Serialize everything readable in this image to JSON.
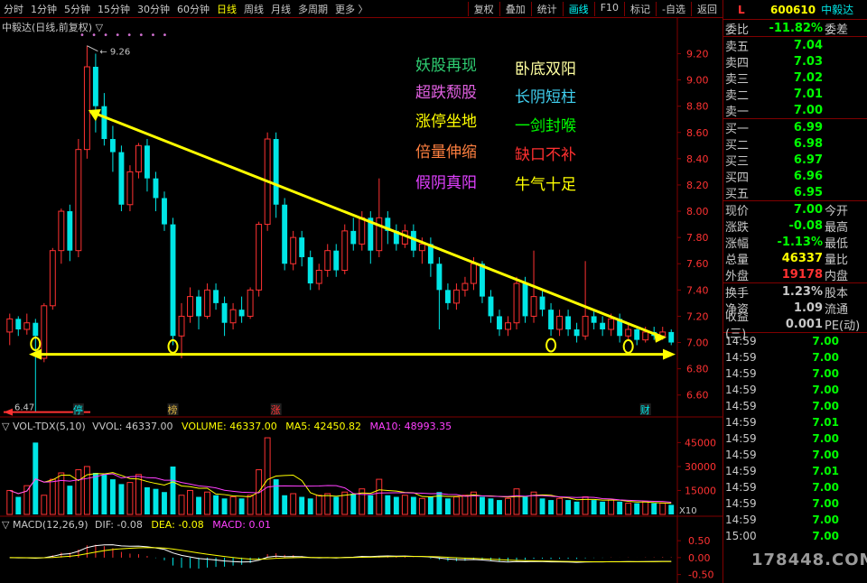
{
  "toolbar": {
    "periods": [
      "分时",
      "1分钟",
      "5分钟",
      "15分钟",
      "30分钟",
      "60分钟",
      "日线",
      "周线",
      "月线",
      "多周期",
      "更多 〉"
    ],
    "active_period": "日线",
    "buttons": [
      "复权",
      "叠加",
      "统计",
      "画线",
      "F10",
      "标记",
      "-自选",
      "返回"
    ],
    "active_button": "画线"
  },
  "chart_title": "中毅达(日线,前复权) ▽",
  "dots": "• • • • • • • •",
  "colors": {
    "up": "#ff3232",
    "down": "#00e5e5",
    "trend": "#ffff00",
    "grid": "#800000"
  },
  "chart_data": {
    "type": "candlestick",
    "ylim": [
      6.55,
      9.32
    ],
    "yticks": [
      "9.20",
      "9.00",
      "8.80",
      "8.60",
      "8.40",
      "8.20",
      "8.00",
      "7.80",
      "7.60",
      "7.40",
      "7.20",
      "7.00",
      "6.80",
      "6.60"
    ],
    "high_label": "9.26",
    "low_label": "6.47",
    "candles": [
      [
        7.08,
        7.18,
        7.22,
        6.98
      ],
      [
        7.18,
        7.1,
        7.2,
        7.05
      ],
      [
        7.1,
        7.15,
        7.22,
        7.06
      ],
      [
        7.15,
        7.05,
        7.18,
        6.47
      ],
      [
        6.88,
        7.28,
        7.3,
        6.85
      ],
      [
        7.28,
        7.7,
        7.72,
        7.25
      ],
      [
        7.7,
        8.0,
        8.02,
        7.6
      ],
      [
        8.0,
        7.7,
        8.05,
        7.62
      ],
      [
        7.7,
        8.47,
        8.55,
        7.65
      ],
      [
        8.47,
        9.1,
        9.26,
        8.4
      ],
      [
        9.1,
        8.8,
        9.2,
        8.6
      ],
      [
        8.8,
        8.55,
        8.9,
        8.5
      ],
      [
        8.55,
        8.45,
        8.65,
        8.3
      ],
      [
        8.45,
        8.05,
        8.5,
        8.0
      ],
      [
        8.05,
        8.3,
        8.35,
        8.0
      ],
      [
        8.3,
        8.5,
        8.52,
        8.25
      ],
      [
        8.5,
        8.25,
        8.55,
        8.15
      ],
      [
        8.25,
        8.1,
        8.3,
        8.0
      ],
      [
        8.1,
        7.9,
        8.15,
        7.85
      ],
      [
        7.9,
        7.05,
        7.95,
        6.98
      ],
      [
        7.05,
        7.2,
        7.3,
        6.88
      ],
      [
        7.2,
        7.35,
        7.42,
        7.15
      ],
      [
        7.35,
        7.2,
        7.4,
        7.1
      ],
      [
        7.2,
        7.4,
        7.45,
        7.18
      ],
      [
        7.4,
        7.3,
        7.45,
        7.25
      ],
      [
        7.3,
        7.15,
        7.35,
        7.05
      ],
      [
        7.15,
        7.25,
        7.3,
        7.1
      ],
      [
        7.25,
        7.2,
        7.35,
        7.15
      ],
      [
        7.2,
        7.4,
        7.42,
        7.18
      ],
      [
        7.4,
        7.9,
        7.92,
        7.35
      ],
      [
        7.9,
        8.55,
        8.6,
        7.85
      ],
      [
        8.55,
        8.05,
        8.6,
        7.95
      ],
      [
        8.05,
        7.6,
        8.1,
        7.55
      ],
      [
        7.6,
        7.8,
        7.85,
        7.55
      ],
      [
        7.8,
        7.65,
        7.85,
        7.58
      ],
      [
        7.65,
        7.45,
        7.7,
        7.4
      ],
      [
        7.45,
        7.55,
        7.6,
        7.4
      ],
      [
        7.55,
        7.7,
        7.75,
        7.5
      ],
      [
        7.7,
        7.55,
        7.75,
        7.5
      ],
      [
        7.55,
        7.85,
        7.9,
        7.52
      ],
      [
        7.85,
        7.75,
        7.95,
        7.7
      ],
      [
        7.75,
        7.95,
        8.0,
        7.7
      ],
      [
        7.95,
        7.7,
        8.0,
        7.6
      ],
      [
        7.7,
        7.95,
        8.25,
        7.65
      ],
      [
        7.95,
        7.85,
        8.0,
        7.75
      ],
      [
        7.85,
        7.75,
        7.9,
        7.7
      ],
      [
        7.75,
        7.85,
        7.9,
        7.72
      ],
      [
        7.85,
        7.7,
        7.9,
        7.65
      ],
      [
        7.7,
        7.75,
        7.8,
        7.6
      ],
      [
        7.75,
        7.6,
        7.8,
        7.5
      ],
      [
        7.6,
        7.4,
        7.65,
        7.1
      ],
      [
        7.4,
        7.3,
        7.45,
        7.25
      ],
      [
        7.3,
        7.4,
        7.45,
        7.25
      ],
      [
        7.4,
        7.45,
        7.5,
        7.35
      ],
      [
        7.45,
        7.6,
        7.65,
        7.4
      ],
      [
        7.6,
        7.35,
        7.62,
        7.3
      ],
      [
        7.35,
        7.2,
        7.4,
        7.15
      ],
      [
        7.2,
        7.1,
        7.25,
        7.05
      ],
      [
        7.1,
        7.15,
        7.2,
        7.05
      ],
      [
        7.15,
        7.45,
        7.5,
        7.1
      ],
      [
        7.45,
        7.2,
        7.5,
        7.15
      ],
      [
        7.2,
        7.35,
        7.7,
        7.15
      ],
      [
        7.35,
        7.25,
        7.4,
        7.2
      ],
      [
        7.25,
        7.1,
        7.3,
        7.05
      ],
      [
        7.1,
        7.2,
        7.25,
        7.05
      ],
      [
        7.2,
        7.1,
        7.25,
        7.05
      ],
      [
        7.1,
        7.05,
        7.15,
        7.0
      ],
      [
        7.05,
        7.2,
        7.62,
        7.02
      ],
      [
        7.2,
        7.15,
        7.25,
        7.1
      ],
      [
        7.15,
        7.1,
        7.2,
        7.05
      ],
      [
        7.1,
        7.18,
        7.22,
        7.05
      ],
      [
        7.18,
        7.05,
        7.22,
        7.0
      ],
      [
        7.05,
        7.1,
        7.15,
        7.02
      ],
      [
        7.1,
        7.02,
        7.12,
        6.98
      ],
      [
        7.02,
        7.08,
        7.12,
        7.0
      ],
      [
        7.08,
        7.05,
        7.12,
        7.02
      ],
      [
        7.05,
        7.08,
        7.12,
        7.02
      ],
      [
        7.08,
        7.0,
        7.1,
        6.98
      ]
    ],
    "volumes": [
      15000,
      11000,
      18000,
      45000,
      12000,
      22000,
      26000,
      18000,
      28000,
      30000,
      26000,
      25000,
      22000,
      19000,
      20000,
      25000,
      17000,
      16000,
      14000,
      30000,
      12000,
      15000,
      11000,
      14000,
      12000,
      10000,
      11000,
      10000,
      12000,
      28000,
      48000,
      22000,
      12000,
      13000,
      11000,
      10000,
      12000,
      13000,
      11000,
      14000,
      13000,
      16000,
      12000,
      22000,
      12000,
      11000,
      12000,
      11000,
      10000,
      11000,
      14000,
      10000,
      11000,
      12000,
      14000,
      11000,
      10000,
      9000,
      10000,
      16000,
      11000,
      14000,
      10000,
      9000,
      10000,
      9000,
      8000,
      11000,
      9000,
      8000,
      9000,
      8000,
      7000,
      7000,
      8000,
      7000,
      7000,
      6000
    ],
    "vol_yticks": [
      "45000",
      "30000",
      "15000"
    ],
    "vol_ylim": [
      0,
      52000
    ],
    "macd_yticks": [
      "0.50",
      "0.00",
      "-0.50"
    ],
    "macd_ylim": [
      -0.75,
      0.85
    ],
    "markers": [
      {
        "text": "停",
        "index": 8,
        "color": "#00e5e5"
      },
      {
        "text": "榜",
        "index": 19,
        "color": "#d8b040"
      },
      {
        "text": "涨",
        "index": 31,
        "color": "#ff3232"
      },
      {
        "text": "财",
        "index": 74,
        "color": "#00e5e5"
      }
    ]
  },
  "captions": [
    {
      "text": "妖股再现",
      "color": "#2ecc71"
    },
    {
      "text": "卧底双阳",
      "color": "#ffffa0"
    },
    {
      "text": "超跌颓股",
      "color": "#e060e0"
    },
    {
      "text": "长阴短柱",
      "color": "#40d0f0"
    },
    {
      "text": "涨停坐地",
      "color": "#ffff00"
    },
    {
      "text": "一剑封喉",
      "color": "#00ff00"
    },
    {
      "text": "倍量伸缩",
      "color": "#ff8040"
    },
    {
      "text": "缺口不补",
      "color": "#ff3030"
    },
    {
      "text": "假阴真阳",
      "color": "#e040ff"
    },
    {
      "text": "牛气十足",
      "color": "#ffff00"
    }
  ],
  "vol_header": {
    "name": "▽ VOL-TDX(5,10)",
    "vvol": "VVOL: 46337.00",
    "volume": "VOLUME: 46337.00",
    "ma5": "MA5: 42450.82",
    "ma10": "MA10: 48993.35"
  },
  "x10_label": "X10",
  "macd_header": {
    "name": "▽ MACD(12,26,9)",
    "dif": "DIF: -0.08",
    "dea": "DEA: -0.08",
    "macd": "MACD: 0.01"
  },
  "right_panel": {
    "level": "L",
    "code": "600610",
    "name": "中毅达",
    "weibi_label": "委比",
    "weibi_value": "-11.82%",
    "weicha_label": "委差",
    "sells": [
      {
        "label": "卖五",
        "price": "7.04"
      },
      {
        "label": "卖四",
        "price": "7.03"
      },
      {
        "label": "卖三",
        "price": "7.02"
      },
      {
        "label": "卖二",
        "price": "7.01"
      },
      {
        "label": "卖一",
        "price": "7.00"
      }
    ],
    "buys": [
      {
        "label": "买一",
        "price": "6.99"
      },
      {
        "label": "买二",
        "price": "6.98"
      },
      {
        "label": "买三",
        "price": "6.97"
      },
      {
        "label": "买四",
        "price": "6.96"
      },
      {
        "label": "买五",
        "price": "6.95"
      }
    ],
    "stats1": [
      {
        "l": "现价",
        "v": "7.00",
        "c": "#00ff00",
        "r": "今开"
      },
      {
        "l": "涨跌",
        "v": "-0.08",
        "c": "#00ff00",
        "r": "最高"
      },
      {
        "l": "涨幅",
        "v": "-1.13%",
        "c": "#00ff00",
        "r": "最低"
      },
      {
        "l": "总量",
        "v": "46337",
        "c": "#ffff00",
        "r": "量比"
      },
      {
        "l": "外盘",
        "v": "19178",
        "c": "#ff3232",
        "r": "内盘"
      }
    ],
    "stats2": [
      {
        "l": "换手",
        "v": "1.23%",
        "c": "#c8c8c8",
        "r": "股本"
      },
      {
        "l": "净资",
        "v": "1.09",
        "c": "#c8c8c8",
        "r": "流通"
      },
      {
        "l": "收益(三)",
        "v": "0.001",
        "c": "#c8c8c8",
        "r": "PE(动)"
      }
    ],
    "ticks": [
      {
        "t": "14:59",
        "p": "7.00"
      },
      {
        "t": "14:59",
        "p": "7.00"
      },
      {
        "t": "14:59",
        "p": "7.00"
      },
      {
        "t": "14:59",
        "p": "7.00"
      },
      {
        "t": "14:59",
        "p": "7.00"
      },
      {
        "t": "14:59",
        "p": "7.01"
      },
      {
        "t": "14:59",
        "p": "7.00"
      },
      {
        "t": "14:59",
        "p": "7.00"
      },
      {
        "t": "14:59",
        "p": "7.01"
      },
      {
        "t": "14:59",
        "p": "7.00"
      },
      {
        "t": "14:59",
        "p": "7.00"
      },
      {
        "t": "14:59",
        "p": "7.00"
      },
      {
        "t": "15:00",
        "p": "7.00"
      }
    ]
  },
  "watermark": "178448.COM"
}
